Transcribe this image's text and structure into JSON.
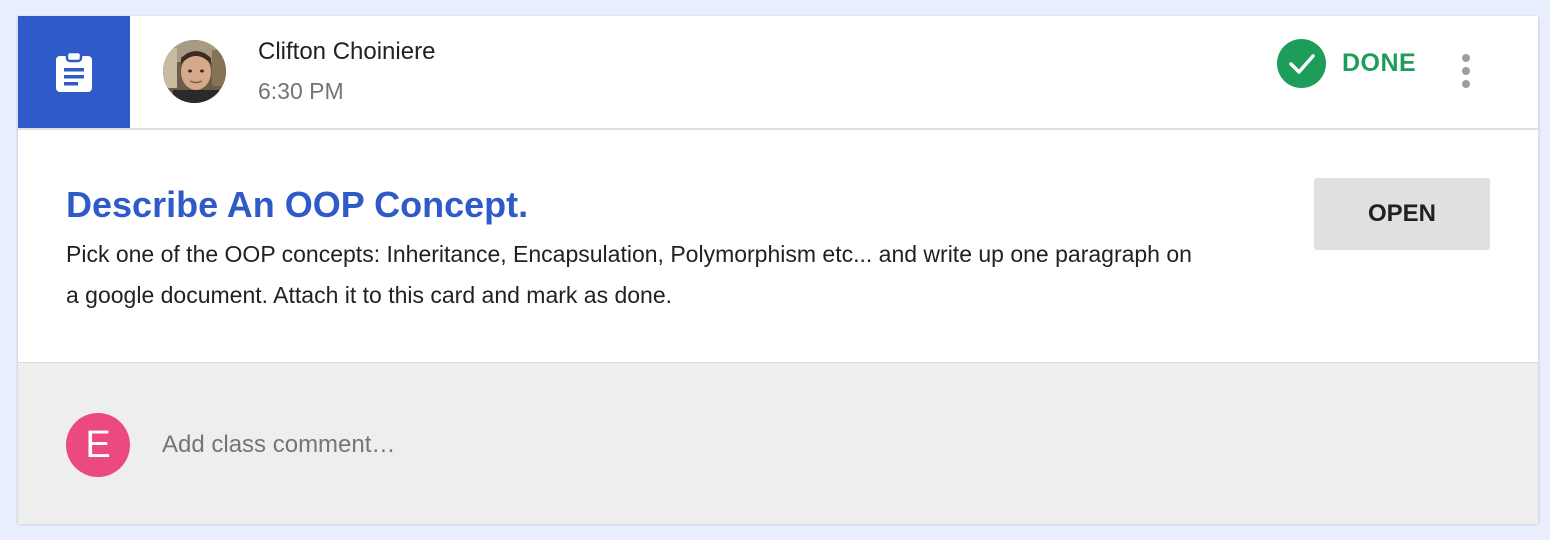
{
  "post": {
    "author": "Clifton Choiniere",
    "time": "6:30 PM",
    "status": "DONE",
    "type_icon": "assignment-icon"
  },
  "assignment": {
    "title": "Describe An OOP Concept.",
    "description": "Pick one of the OOP concepts: Inheritance, Encapsulation, Polymorphism etc... and write up one paragraph on a google document. Attach it to this card and mark as done.",
    "open_label": "OPEN"
  },
  "comment": {
    "user_initial": "E",
    "placeholder": "Add class comment…"
  },
  "colors": {
    "accent": "#2e5bc8",
    "done": "#1e9d5a",
    "user_avatar": "#ea4a7e"
  }
}
